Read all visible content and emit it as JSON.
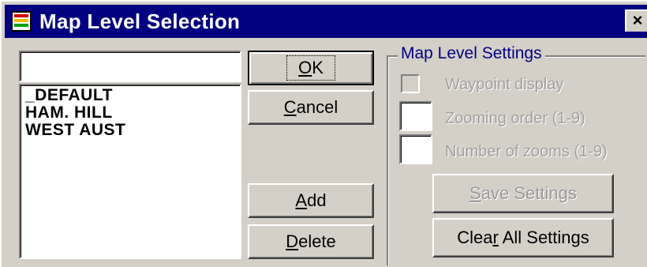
{
  "window": {
    "title": "Map Level Selection",
    "close_glyph": "×",
    "icon": "map-app-icon"
  },
  "search": {
    "value": ""
  },
  "map_levels": {
    "items": [
      "_DEFAULT",
      "HAM. HILL",
      "WEST AUST"
    ]
  },
  "buttons": {
    "ok": {
      "mnemonic": "O",
      "rest": "K"
    },
    "cancel": {
      "mnemonic": "C",
      "rest": "ancel"
    },
    "add": {
      "mnemonic": "A",
      "rest": "dd"
    },
    "delete": {
      "mnemonic": "D",
      "rest": "elete"
    }
  },
  "settings": {
    "group_title": "Map Level Settings",
    "waypoint_label": "Waypoint display",
    "waypoint_checked": false,
    "zoom_order_label": "Zooming order (1-9)",
    "zoom_order_value": "",
    "zoom_count_label": "Number of zooms (1-9)",
    "zoom_count_value": "",
    "save_button": {
      "mnemonic": "S",
      "rest": "ave Settings"
    },
    "clear_button": {
      "before": "Clea",
      "mnemonic": "r",
      "rest": " All Settings"
    }
  },
  "colors": {
    "title_bar": "#000080",
    "face": "#d4d0c8",
    "disabled_text": "#a0a0a0"
  }
}
